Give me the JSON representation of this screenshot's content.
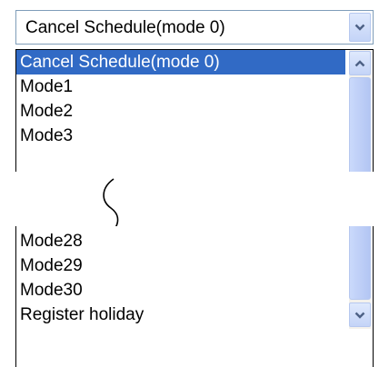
{
  "dropdown": {
    "selected_value": "Cancel Schedule(mode 0)"
  },
  "list_top": {
    "items": [
      {
        "label": "Cancel Schedule(mode 0)",
        "selected": true
      },
      {
        "label": "Mode1",
        "selected": false
      },
      {
        "label": "Mode2",
        "selected": false
      },
      {
        "label": "Mode3",
        "selected": false
      }
    ]
  },
  "list_bottom": {
    "items": [
      {
        "label": "Mode28",
        "selected": false
      },
      {
        "label": "Mode29",
        "selected": false
      },
      {
        "label": "Mode30",
        "selected": false
      },
      {
        "label": "Register holiday",
        "selected": false
      }
    ]
  },
  "icons": {
    "dropdown_arrow": "chevron-down-icon",
    "scroll_up": "chevron-up-icon",
    "scroll_down": "chevron-down-icon",
    "break_mark": "omission-break-icon"
  },
  "colors": {
    "selection_bg": "#316ac5",
    "selection_text": "#ffffff",
    "chevron": "#4d6185",
    "border": "#7f9db9"
  }
}
